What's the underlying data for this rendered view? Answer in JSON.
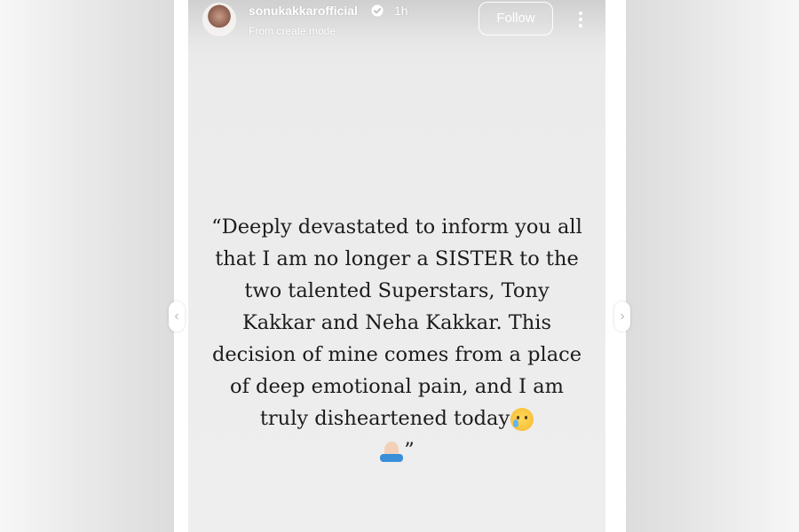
{
  "story": {
    "username": "sonukakkarofficial",
    "time_ago": "1h",
    "subtext": "From create mode",
    "follow_label": "Follow",
    "quote_text": "“Deeply devastated to inform you all that I am no longer a SISTER to the two talented Superstars, Tony Kakkar and Neha Kakkar. This decision of mine comes from a place of deep emotional pain, and I am truly disheartened today",
    "quote_close": "”"
  },
  "icons": {
    "avatar": "profile-photo",
    "verified": "verified-badge-icon",
    "more": "more-options-icon",
    "prev": "chevron-left-icon",
    "next": "chevron-right-icon",
    "emoji_1": "crying-face-emoji",
    "emoji_2": "folded-hands-emoji"
  },
  "colors": {
    "story_background": "#ececec",
    "text": "#1c1c1c",
    "overlay_text": "#ffffff"
  }
}
